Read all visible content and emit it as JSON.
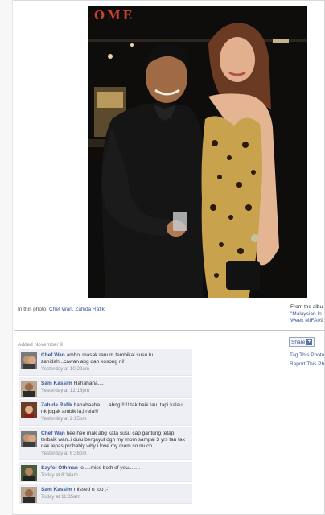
{
  "photo": {
    "sign_text": "OME",
    "alt": "Photo"
  },
  "in_photo": {
    "prefix": "In this photo:",
    "people": [
      "Chef Wan",
      "Zahida Rafik"
    ],
    "separator": ","
  },
  "album": {
    "from_label": "From the albu",
    "name_line1": "\"Malaysian In",
    "name_line2": "Week MIFA09"
  },
  "added": "Added November 9",
  "share": {
    "label": "Share",
    "icon": "plus-icon"
  },
  "actions": {
    "tag": "Tag This Photo",
    "report": "Report This Ph"
  },
  "comments": [
    {
      "author": "Chef Wan",
      "text": "amboi masak ranum tembikai susu tu zahidah...cawan abg dah kosong ni!",
      "time": "Yesterday at 10:29am"
    },
    {
      "author": "Sam Kassim",
      "text": "Hahahaha....",
      "time": "Yesterday at 12:13pm"
    },
    {
      "author": "Zahida Rafik",
      "text": "hahahaaha......abng!!!!!! tak baik tau! tapi kalau nk jugak ambik la,i rela!!!",
      "time": "Yesterday at 2:15pm"
    },
    {
      "author": "Chef Wan",
      "text": "hee hee mak abg kata susu cap gantung tetap terbaik wan..i dulu bergayut dgn my mom sampai 3 yrs tau tak nak lepas.probably why i love my mom so much.",
      "time": "Yesterday at 6:36pm"
    },
    {
      "author": "Sayfol Othman",
      "text": "lol....miss both of you........",
      "time": "Today at 8:14am"
    },
    {
      "author": "Sam Kassim",
      "text": "missed u too ;-)",
      "time": "Today at 11:35am"
    }
  ],
  "colors": {
    "link": "#3b5998",
    "comment_bg": "#edeff4",
    "muted": "#8f8f8f"
  }
}
